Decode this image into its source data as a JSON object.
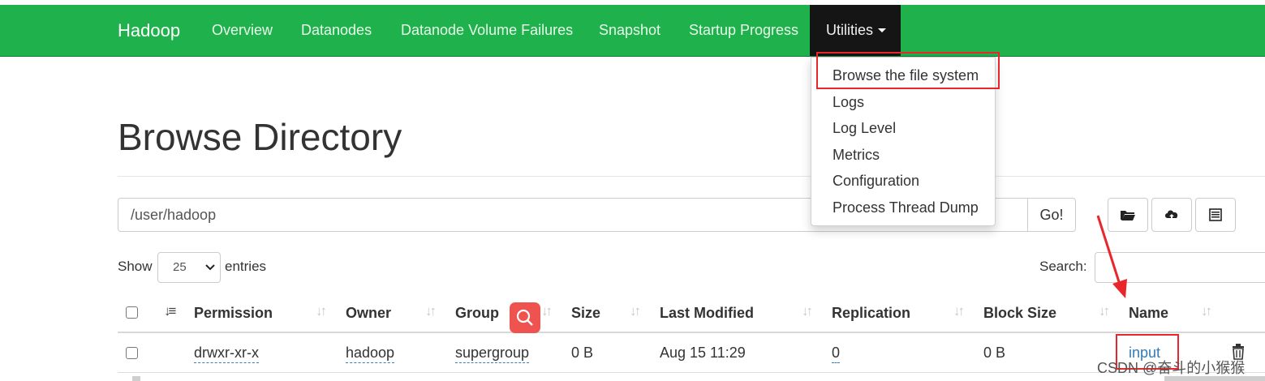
{
  "navbar": {
    "brand": "Hadoop",
    "items": [
      "Overview",
      "Datanodes",
      "Datanode Volume Failures",
      "Snapshot",
      "Startup Progress"
    ],
    "utilities_label": "Utilities",
    "bg_color": "#1fb24c"
  },
  "utilities_menu": {
    "items": [
      "Browse the file system",
      "Logs",
      "Log Level",
      "Metrics",
      "Configuration",
      "Process Thread Dump"
    ]
  },
  "page": {
    "title": "Browse Directory",
    "path_value": "/user/hadoop",
    "go_label": "Go!",
    "toolbar_icons": [
      "folder-open-icon",
      "cloud-upload-icon",
      "list-icon"
    ]
  },
  "table_controls": {
    "show_label": "Show",
    "entries_value": "25",
    "entries_label": "entries",
    "search_label": "Search:"
  },
  "table": {
    "headers": [
      "Permission",
      "Owner",
      "Group",
      "Size",
      "Last Modified",
      "Replication",
      "Block Size",
      "Name"
    ],
    "rows": [
      {
        "permission": "drwxr-xr-x",
        "owner": "hadoop",
        "group": "supergroup",
        "size": "0 B",
        "last_modified": "Aug 15 11:29",
        "replication": "0",
        "block_size": "0 B",
        "name": "input"
      }
    ]
  },
  "annotations": {
    "highlight_color": "#e8262b",
    "watermark": "CSDN @奋斗的小猴猴"
  }
}
